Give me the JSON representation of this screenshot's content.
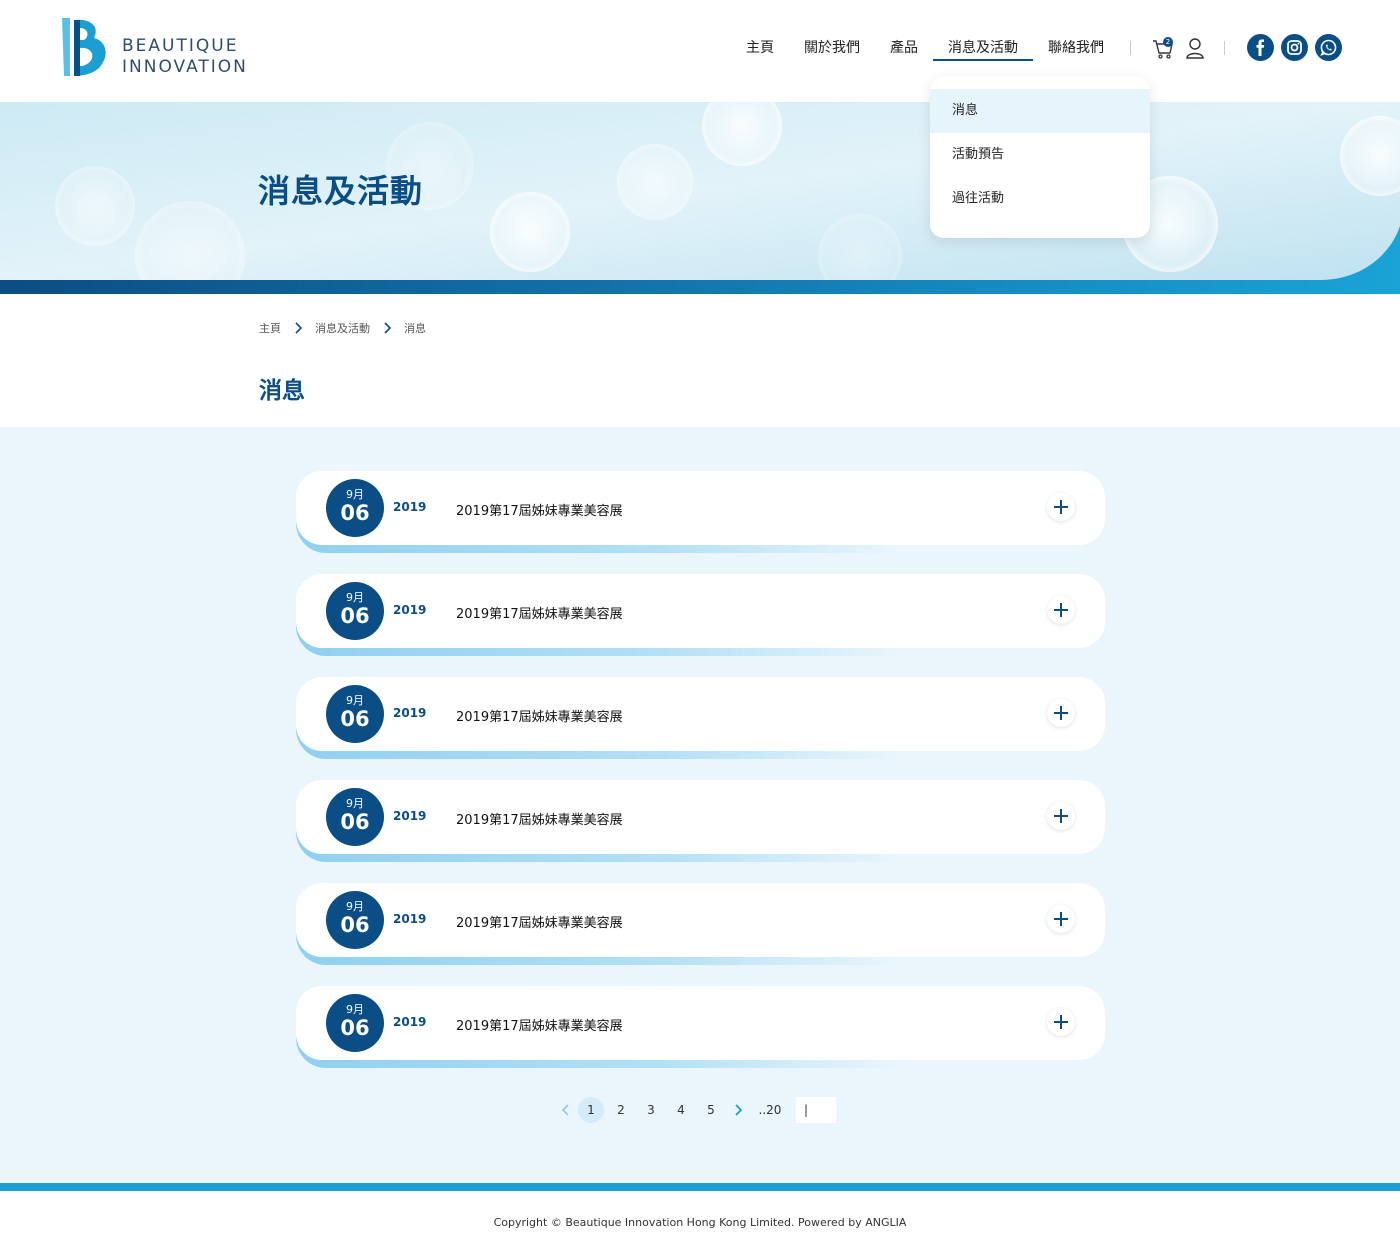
{
  "brand": {
    "line1": "BEAUTIQUE",
    "line2": "INNOVATION"
  },
  "nav": {
    "items": [
      "主頁",
      "關於我們",
      "產品",
      "消息及活動",
      "聯絡我們"
    ],
    "active_index": 3,
    "cart_count": "2"
  },
  "dropdown": {
    "items": [
      "消息",
      "活動預告",
      "過往活動"
    ],
    "active_index": 0
  },
  "banner": {
    "title": "消息及活動"
  },
  "breadcrumb": {
    "items": [
      "主頁",
      "消息及活動",
      "消息"
    ]
  },
  "page": {
    "title": "消息"
  },
  "news": [
    {
      "month": "9月",
      "day": "06",
      "year": "2019",
      "title": "2019第17屆姊妹專業美容展"
    },
    {
      "month": "9月",
      "day": "06",
      "year": "2019",
      "title": "2019第17屆姊妹專業美容展"
    },
    {
      "month": "9月",
      "day": "06",
      "year": "2019",
      "title": "2019第17屆姊妹專業美容展"
    },
    {
      "month": "9月",
      "day": "06",
      "year": "2019",
      "title": "2019第17屆姊妹專業美容展"
    },
    {
      "month": "9月",
      "day": "06",
      "year": "2019",
      "title": "2019第17屆姊妹專業美容展"
    },
    {
      "month": "9月",
      "day": "06",
      "year": "2019",
      "title": "2019第17屆姊妹專業美容展"
    }
  ],
  "pagination": {
    "pages": [
      "1",
      "2",
      "3",
      "4",
      "5"
    ],
    "current": "1",
    "last": "..20",
    "input_value": "|"
  },
  "footer": {
    "copyright": "Copyright © Beautique Innovation Hong Kong Limited. Powered by ANGLIA"
  },
  "colors": {
    "primary": "#0b4d85",
    "accent": "#1a9fd0",
    "content_bg": "#eaf6fc"
  }
}
